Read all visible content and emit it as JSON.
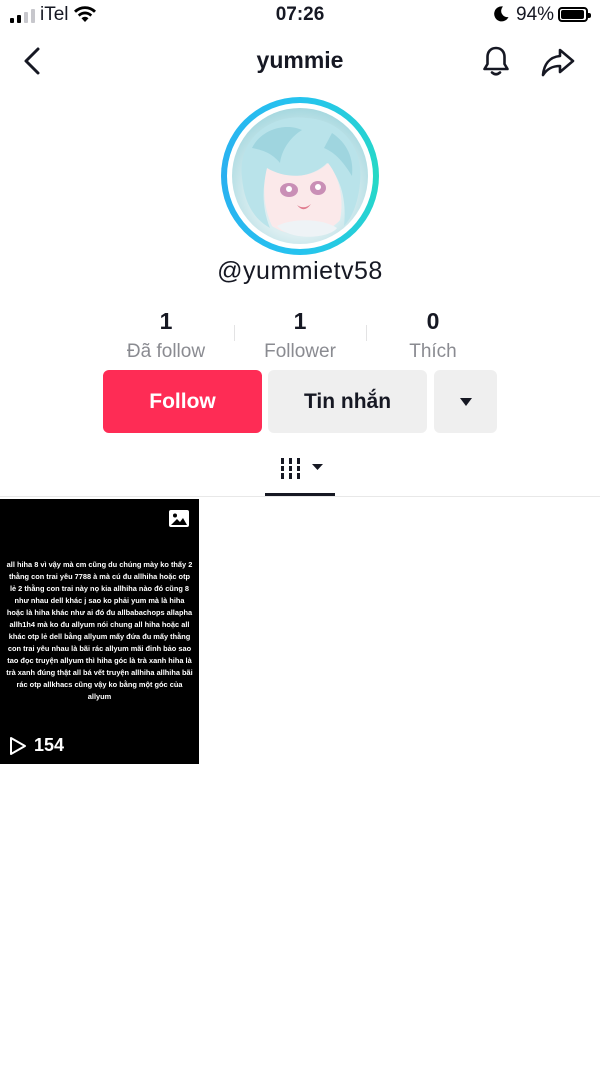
{
  "status_bar": {
    "carrier": "iTel",
    "time": "07:26",
    "battery": "94%",
    "battery_level": 0.94
  },
  "header": {
    "title": "yummie"
  },
  "profile": {
    "username": "@yummietv58",
    "stats": [
      {
        "value": "1",
        "label": "Đã follow"
      },
      {
        "value": "1",
        "label": "Follower"
      },
      {
        "value": "0",
        "label": "Thích"
      }
    ]
  },
  "actions": {
    "follow_label": "Follow",
    "message_label": "Tin nhắn"
  },
  "colors": {
    "accent": "#fe2c55",
    "avatar_ring": "#25c3ef",
    "secondary_button": "#efefef"
  },
  "videos": [
    {
      "caption": "all hiha 8 vì vậy mà cm cũng du chúng mày ko thấy 2 thằng con trai yêu 7788 à mà cú đu allhiha hoặc otp lẻ 2 thằng con trai này nọ kia allhiha nào đó cũng 8 như nhau dell khác j sao ko phải yum mà là hiha hoặc là hiha khác như ai đó đu allbabachops allapha allh1h4 mà ko đu allyum nói chung all hiha hoặc all khác otp lẻ dell bằng allyum mấy đứa đu mấy thằng con trai yêu nhau là bãi rác allyum mãi đỉnh bảo sao tao đọc truyện allyum thì hiha góc là trà xanh hiha là trà xanh đúng thật all bá vết truyện allhiha allhiha bãi rác otp allkhacs cũng vậy ko bằng một góc của allyum",
      "views": "154"
    }
  ]
}
